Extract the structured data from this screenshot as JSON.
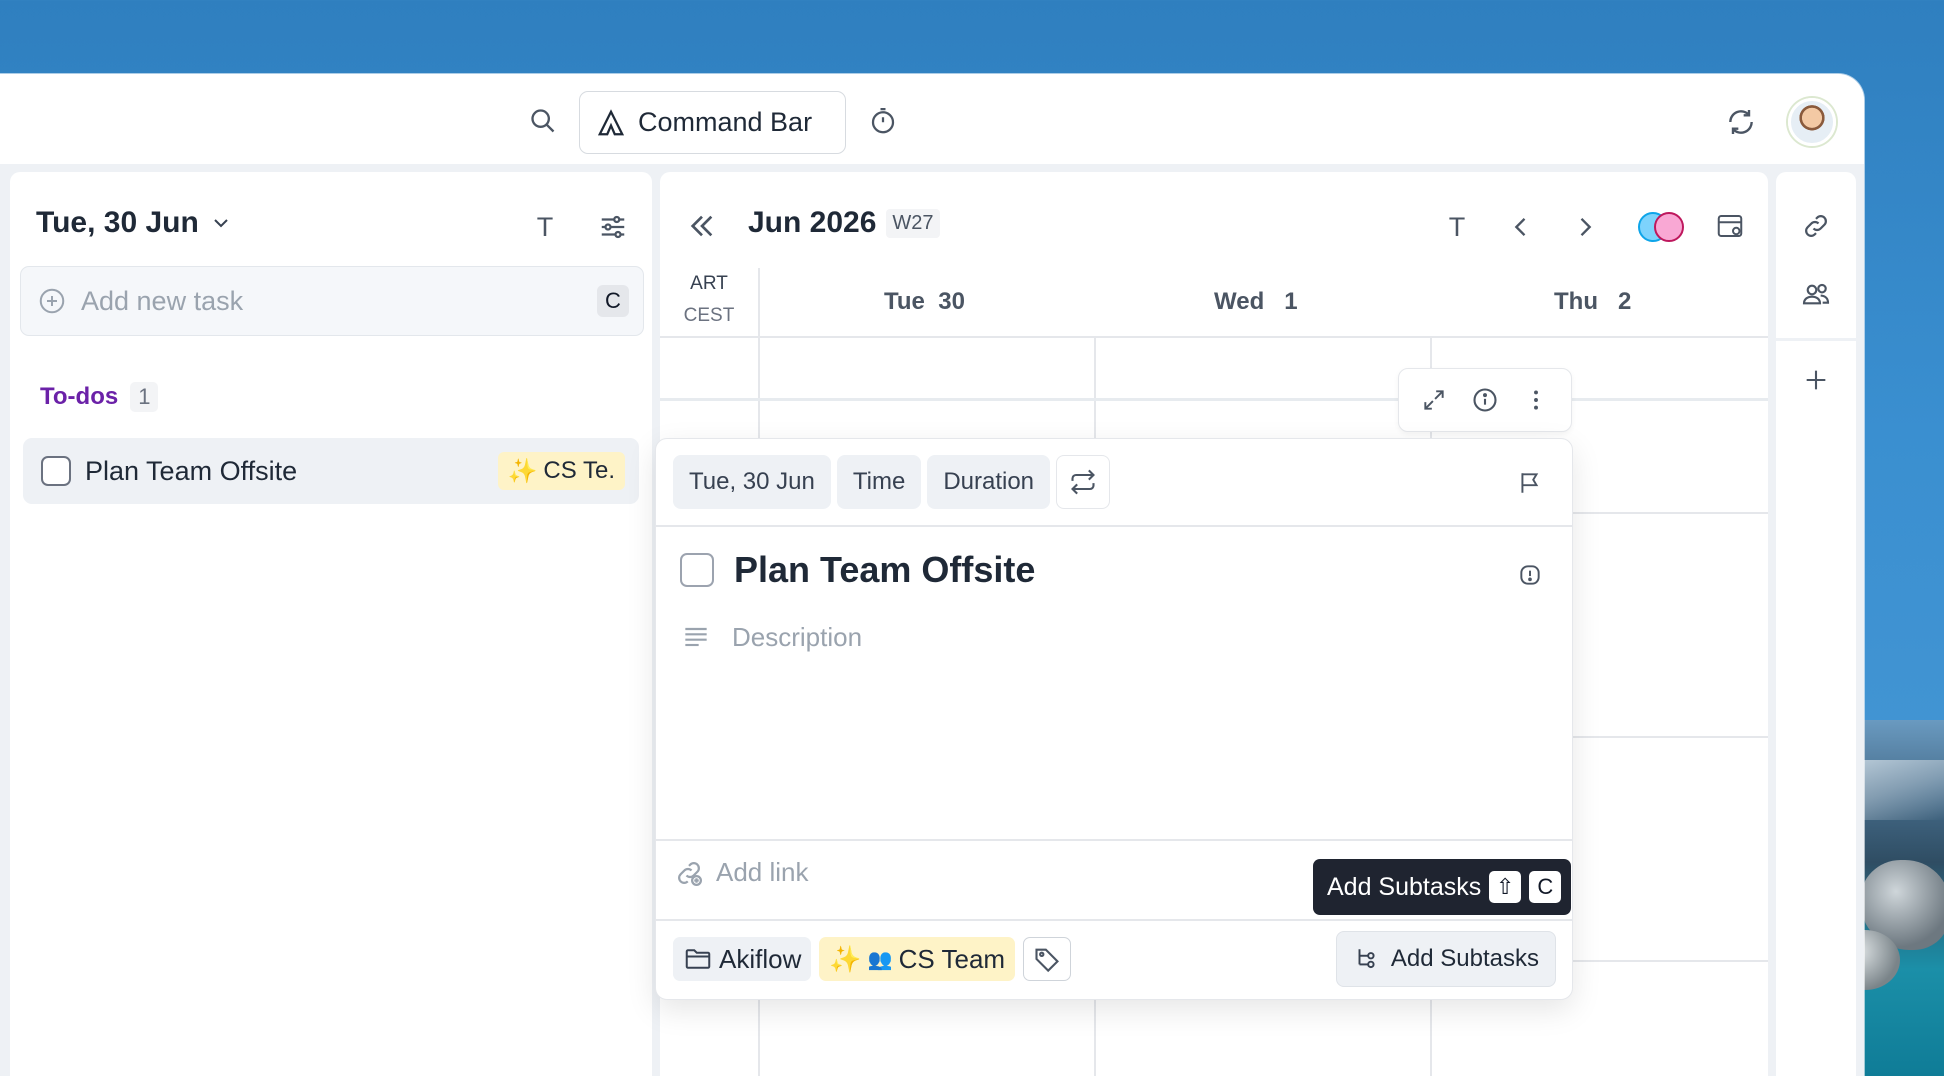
{
  "topbar": {
    "command_bar_label": "Command Bar"
  },
  "left_panel": {
    "date_label": "Tue, 30 Jun",
    "today_shortcut": "T",
    "add_task_placeholder": "Add new task",
    "add_task_shortcut": "C",
    "section_label": "To-dos",
    "section_count": "1",
    "task_title": "Plan Team Offsite",
    "task_tag": "CS Te."
  },
  "calendar": {
    "month_label": "Jun 2026",
    "week_label": "W27",
    "today_shortcut": "T",
    "tz_primary": "ART",
    "tz_secondary": "CEST",
    "days": [
      {
        "name": "Tue",
        "num": "30"
      },
      {
        "name": "Wed",
        "num": "1"
      },
      {
        "name": "Thu",
        "num": "2"
      }
    ]
  },
  "popup": {
    "date_chip": "Tue, 30 Jun",
    "time_chip": "Time",
    "duration_chip": "Duration",
    "title": "Plan Team Offsite",
    "description_placeholder": "Description",
    "link_placeholder": "Add link",
    "project_chip": "Akiflow",
    "tag_chip": "CS Team",
    "add_subtasks_label": "Add Subtasks",
    "tooltip_label": "Add Subtasks",
    "tooltip_key_shift": "⇧",
    "tooltip_key": "C"
  },
  "colors": {
    "accent_purple": "#6b21a8",
    "tag_yellow": "#fef3c7",
    "tooltip_bg": "#1f2430"
  },
  "icons": [
    "search-icon",
    "akiflow-logo-icon",
    "timer-icon",
    "sync-icon",
    "chevron-down-icon",
    "filter-icon",
    "plus-circle-icon",
    "double-chevron-left-icon",
    "chevron-left-icon",
    "chevron-right-icon",
    "calendar-settings-icon",
    "link-icon",
    "people-icon",
    "plus-icon",
    "expand-icon",
    "info-icon",
    "more-vertical-icon",
    "repeat-icon",
    "flag-icon",
    "priority-icon",
    "description-icon",
    "add-link-icon",
    "folder-icon",
    "tag-icon",
    "subtasks-icon",
    "sparkles-icon"
  ]
}
